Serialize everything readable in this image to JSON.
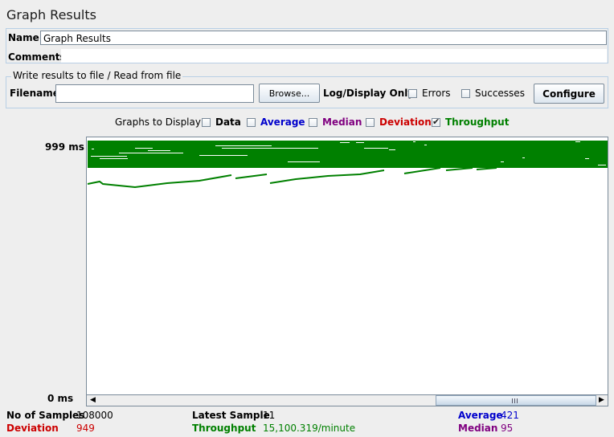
{
  "panel": {
    "title": "Graph Results"
  },
  "name_field": {
    "label": "Name:",
    "value": "Graph Results"
  },
  "comments_field": {
    "label": "Comments:",
    "value": ""
  },
  "file_group": {
    "legend": "Write results to file / Read from file",
    "filename_label": "Filename",
    "filename_value": "",
    "browse_label": "Browse...",
    "log_display_label": "Log/Display Only:",
    "errors_label": "Errors",
    "errors_checked": false,
    "successes_label": "Successes",
    "successes_checked": false,
    "configure_label": "Configure"
  },
  "graphs": {
    "label": "Graphs to Display",
    "options": [
      {
        "label": "Data",
        "checked": false,
        "color": "#000000"
      },
      {
        "label": "Average",
        "checked": false,
        "color": "#0000cc"
      },
      {
        "label": "Median",
        "checked": false,
        "color": "#800080"
      },
      {
        "label": "Deviation",
        "checked": false,
        "color": "#cc0000"
      },
      {
        "label": "Throughput",
        "checked": true,
        "color": "#008000"
      }
    ]
  },
  "chart_data": {
    "type": "line",
    "y_max_label": "999 ms",
    "y_min_label": "0 ms",
    "ylim": [
      0,
      999
    ],
    "series": [
      {
        "name": "Throughput",
        "color": "#008000"
      }
    ]
  },
  "stats": {
    "samples_label": "No of Samples",
    "samples_value": "108000",
    "latest_label": "Latest Sample",
    "latest_value": "11",
    "average_label": "Average",
    "average_value": "421",
    "deviation_label": "Deviation",
    "deviation_value": "949",
    "throughput_label": "Throughput",
    "throughput_value": "15,100.319/minute",
    "median_label": "Median",
    "median_value": "95"
  },
  "colors": {
    "throughput": "#008000",
    "average": "#0000cc",
    "median": "#800080",
    "deviation": "#cc0000"
  }
}
